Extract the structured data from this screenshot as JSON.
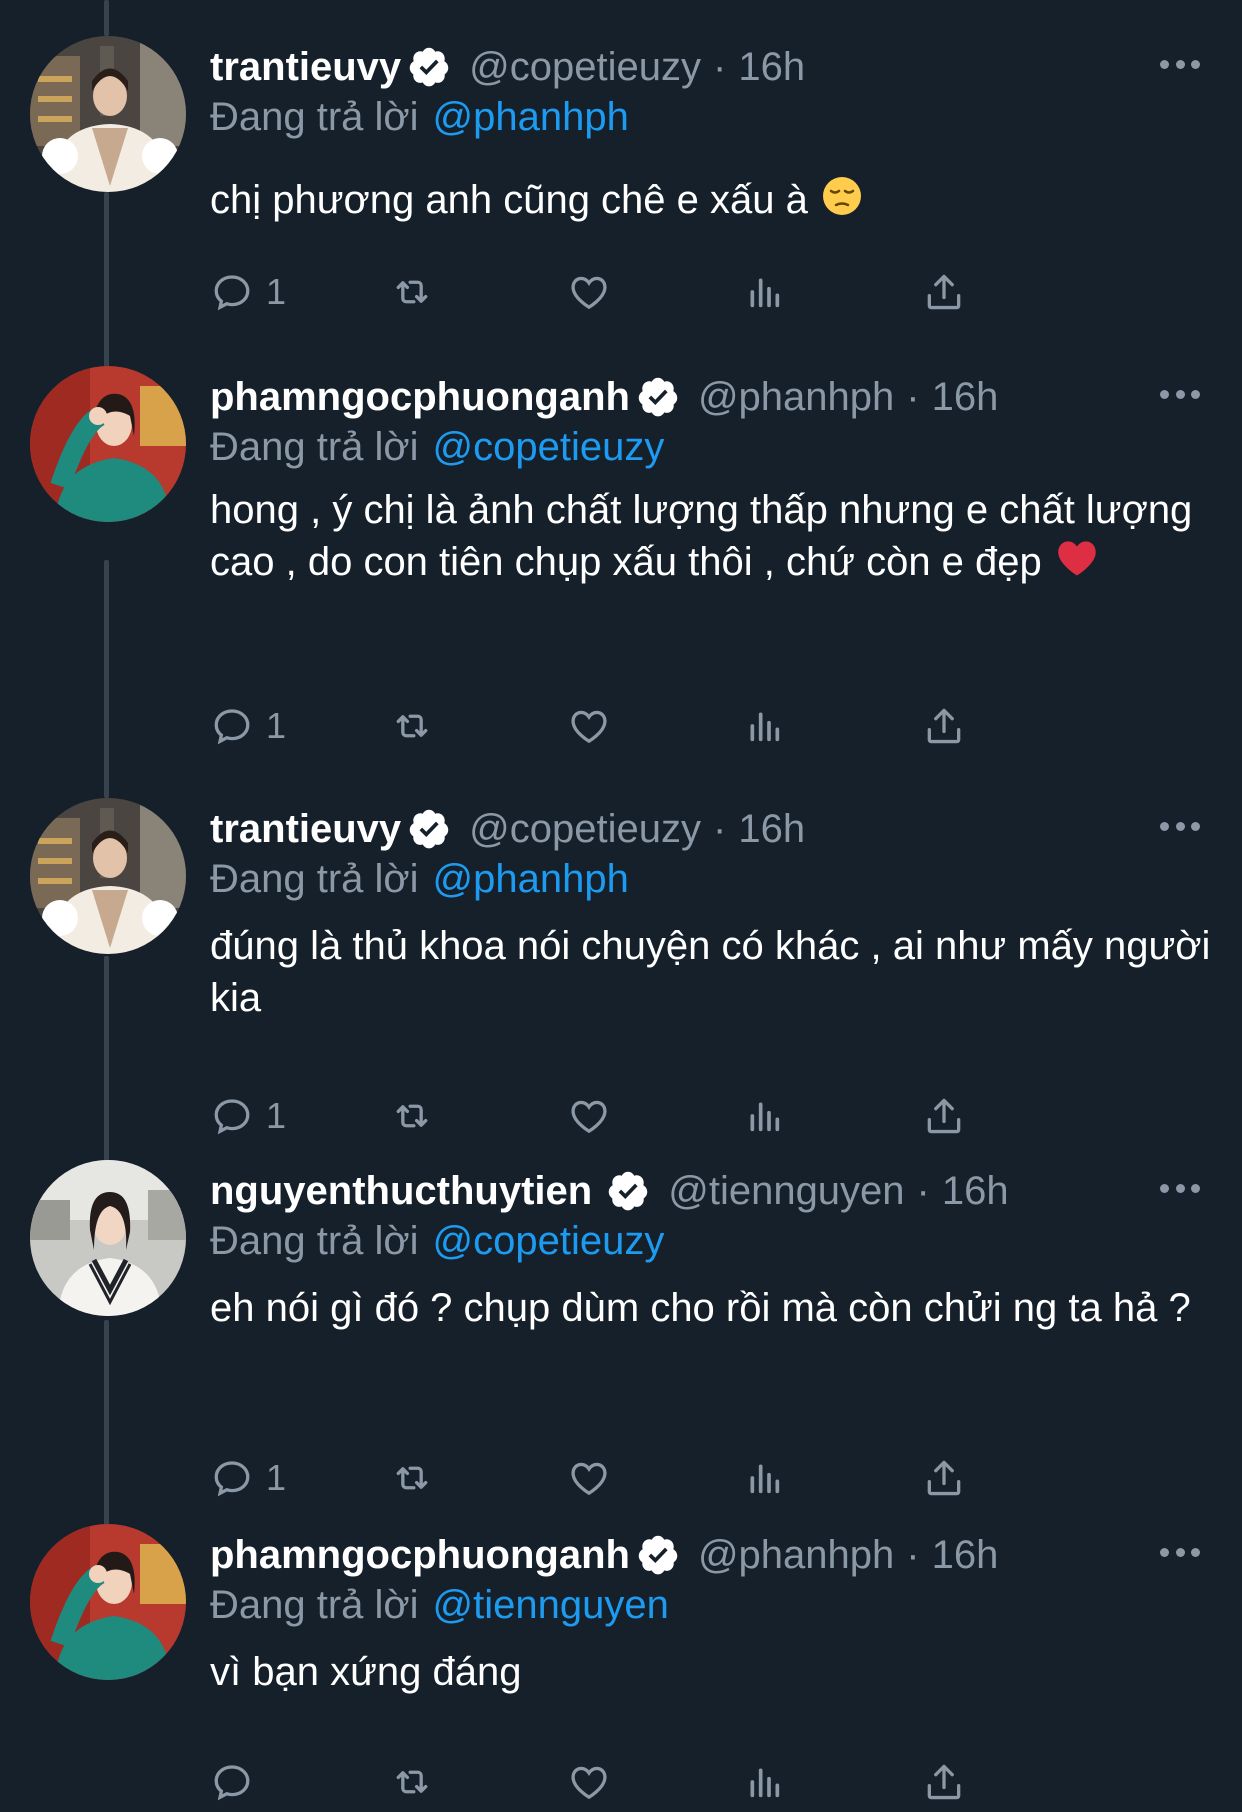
{
  "tweets": [
    {
      "name": "trantieuvy",
      "handle": "@copetieuzy",
      "separator": "·",
      "time": "16h",
      "reply_label": "Đang trả lời",
      "reply_to": "@phanhph",
      "text": "chị phương anh cũng chê e xấu à",
      "emoji": "pensive-face",
      "reply_count": "1"
    },
    {
      "name": "phamngocphuonganh",
      "handle": "@phanhph",
      "separator": "·",
      "time": "16h",
      "reply_label": "Đang trả lời",
      "reply_to": "@copetieuzy",
      "text": "hong , ý chị là ảnh chất lượng thấp nhưng e chất lượng cao , do con tiên chụp xấu thôi , chứ còn e đẹp",
      "emoji": "red-heart",
      "reply_count": "1"
    },
    {
      "name": "trantieuvy",
      "handle": "@copetieuzy",
      "separator": "·",
      "time": "16h",
      "reply_label": "Đang trả lời",
      "reply_to": "@phanhph",
      "text": "đúng là thủ khoa nói chuyện có khác , ai như mấy người kia",
      "reply_count": "1"
    },
    {
      "name": "nguyenthucthuytien",
      "handle": "@tiennguyen",
      "separator": "·",
      "time": "16h",
      "reply_label": "Đang trả lời",
      "reply_to": "@copetieuzy",
      "text": "eh nói gì đó ? chụp dùm cho rồi mà còn chửi ng ta hả ?",
      "reply_count": "1"
    },
    {
      "name": "phamngocphuonganh",
      "handle": "@phanhph",
      "separator": "·",
      "time": "16h",
      "reply_label": "Đang trả lời",
      "reply_to": "@tiennguyen",
      "text": "vì bạn xứng đáng",
      "reply_count": ""
    }
  ],
  "colors": {
    "background": "#15202b",
    "secondary_text": "#8b98a5",
    "mention": "#1d9bf0",
    "thread_line": "#38444d"
  },
  "icons": [
    "reply-icon",
    "retweet-icon",
    "like-icon",
    "views-icon",
    "share-icon",
    "verified-badge-icon",
    "more-icon"
  ]
}
